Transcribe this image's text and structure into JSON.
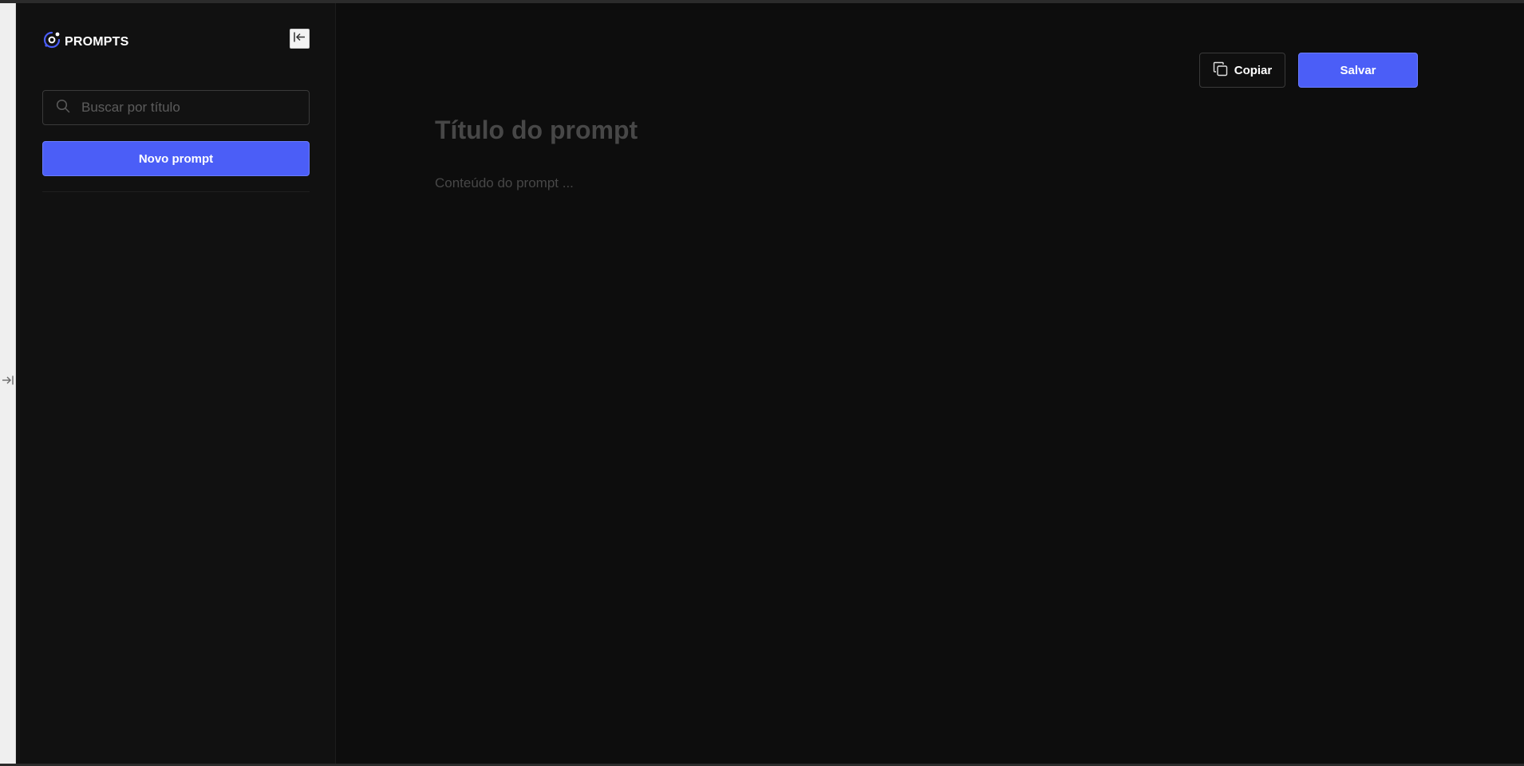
{
  "brand": {
    "name": "PROMPTS",
    "icon": "logo-orbit-icon",
    "accent": "#4b5ef7"
  },
  "sidebar": {
    "collapse_icon": "collapse-left-icon",
    "search": {
      "placeholder": "Buscar por título",
      "value": "",
      "icon": "search-icon"
    },
    "new_prompt_label": "Novo prompt",
    "items": []
  },
  "rail": {
    "expand_icon": "expand-right-icon"
  },
  "toolbar": {
    "copy_label": "Copiar",
    "copy_icon": "copy-icon",
    "save_label": "Salvar"
  },
  "editor": {
    "title_placeholder": "Título do prompt",
    "title_value": "",
    "content_placeholder": "Conteúdo do prompt ...",
    "content_value": ""
  },
  "colors": {
    "primary": "#4b5ef7",
    "background": "#0d0d0d",
    "sidebar_bg": "#111111",
    "placeholder": "#474747"
  }
}
